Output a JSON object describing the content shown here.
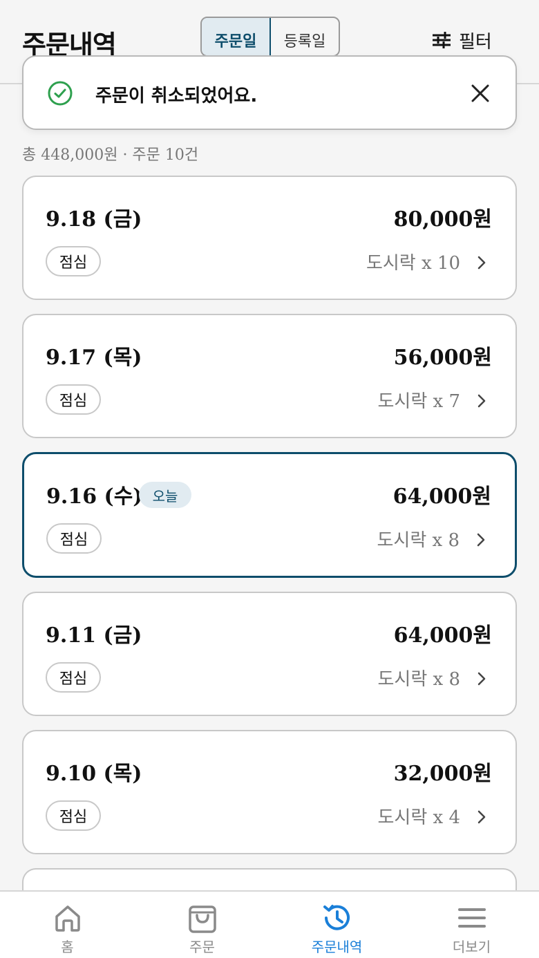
{
  "header": {
    "title": "주문내역",
    "tabs": [
      {
        "label": "주문일",
        "active": true
      },
      {
        "label": "등록일",
        "active": false
      }
    ],
    "filter_label": "필터"
  },
  "toast": {
    "message": "주문이 취소되었어요."
  },
  "summary": {
    "text": "총 448,000원 · 주문 10건"
  },
  "orders": [
    {
      "date": "9.18 (금)",
      "amount": "80,000원",
      "meal": "점심",
      "items": "도시락 x 10",
      "today": false
    },
    {
      "date": "9.17 (목)",
      "amount": "56,000원",
      "meal": "점심",
      "items": "도시락 x 7",
      "today": false
    },
    {
      "date": "9.16 (수)",
      "amount": "64,000원",
      "meal": "점심",
      "items": "도시락 x 8",
      "today": true,
      "today_label": "오늘"
    },
    {
      "date": "9.11 (금)",
      "amount": "64,000원",
      "meal": "점심",
      "items": "도시락 x 8",
      "today": false
    },
    {
      "date": "9.10 (목)",
      "amount": "32,000원",
      "meal": "점심",
      "items": "도시락 x 4",
      "today": false
    }
  ],
  "nav": [
    {
      "label": "홈",
      "icon": "home-icon",
      "active": false
    },
    {
      "label": "주문",
      "icon": "shopping-bag-icon",
      "active": false
    },
    {
      "label": "주문내역",
      "icon": "history-icon",
      "active": true
    },
    {
      "label": "더보기",
      "icon": "menu-icon",
      "active": false
    }
  ],
  "colors": {
    "accent": "#0d4d6b",
    "nav_active": "#1a7fd8",
    "success": "#2ea04e"
  }
}
